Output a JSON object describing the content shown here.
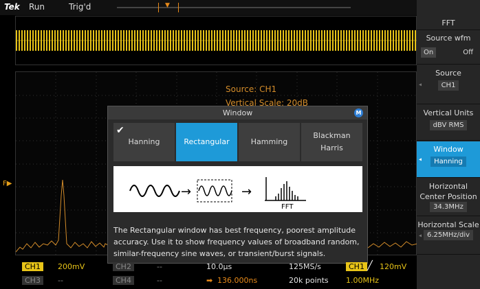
{
  "topbar": {
    "brand": "Tek",
    "run_state": "Run",
    "trigger_state": "Trig'd"
  },
  "spectrum_info": {
    "source": "Source: CH1",
    "vertical_scale": "Vertical Scale: 20dB"
  },
  "dialog": {
    "title": "Window",
    "badge": "M",
    "tabs": [
      {
        "label": "Hanning"
      },
      {
        "label": "Rectangular"
      },
      {
        "label": "Hamming"
      },
      {
        "label": "Blackman\nHarris"
      }
    ],
    "diagram_label": "FFT",
    "description": "The Rectangular window has best frequency, poorest amplitude accuracy. Use it to show frequency values of broadband random, similar-frequency sine waves, or transient/burst signals."
  },
  "menu": {
    "title": "FFT",
    "source_wfm": {
      "label": "Source wfm",
      "on": "On",
      "off": "Off"
    },
    "source": {
      "label": "Source",
      "value": "CH1"
    },
    "vertical_units": {
      "label": "Vertical Units",
      "value": "dBV RMS"
    },
    "window": {
      "label": "Window",
      "value": "Hanning"
    },
    "hcenter": {
      "label": "Horizontal Center Position",
      "value": "34.3MHz"
    },
    "hscale": {
      "label": "Horizontal Scale",
      "value": "6.25MHz/div"
    }
  },
  "status": {
    "ch1": "CH1",
    "ch1_scale": "200mV",
    "ch2": "CH2",
    "ch2_scale": "--",
    "ch3": "CH3",
    "ch3_scale": "--",
    "ch4": "CH4",
    "ch4_scale": "--",
    "timebase": "10.0µs",
    "sample_rate": "125MS/s",
    "trig_ch": "CH1",
    "trig_level": "120mV",
    "position": "136.000ns",
    "record_length": "20k points",
    "frequency": "1.00MHz"
  },
  "colors": {
    "accent": "#1e9ad8",
    "ch1": "#e8c418",
    "spectrum": "#d38c2a"
  }
}
